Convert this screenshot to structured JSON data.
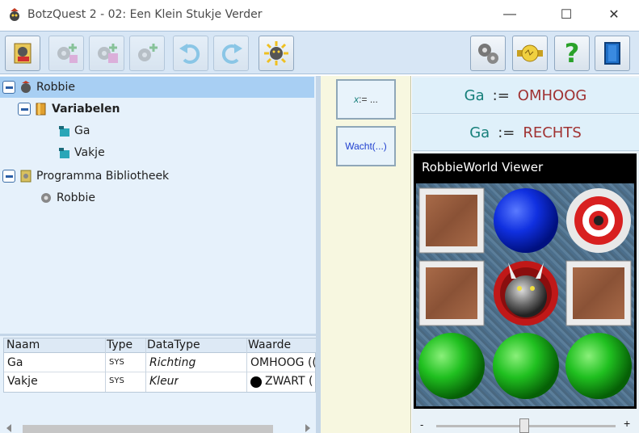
{
  "window": {
    "title": "BotzQuest 2 - 02: Een Klein Stukje Verder",
    "minimize_label": "—",
    "maximize_label": "☐",
    "close_label": "✕"
  },
  "toolbar": {
    "left_buttons": [
      "robot-editor",
      "add-gear",
      "add-gear-2",
      "add-gear-3",
      "undo",
      "redo",
      "run"
    ],
    "right_buttons": [
      "settings",
      "badge",
      "help",
      "exit"
    ],
    "help_glyph": "?"
  },
  "tree": {
    "root_label": "Robbie",
    "variables_label": "Variabelen",
    "var_ga": "Ga",
    "var_vakje": "Vakje",
    "library_label": "Programma Bibliotheek",
    "library_robbie": "Robbie"
  },
  "grid": {
    "columns": [
      "Naam",
      "Type",
      "DataType",
      "Waarde"
    ],
    "rows": [
      {
        "naam": "Ga",
        "type": "SYS",
        "datatype": "Richting",
        "waarde": "OMHOOG (("
      },
      {
        "naam": "Vakje",
        "type": "SYS",
        "datatype": "Kleur",
        "waarde": "ZWART ("
      }
    ]
  },
  "commands": {
    "assign_var": "x",
    "assign_op": " := ...",
    "wait_label": "Wacht(...)"
  },
  "statements": [
    {
      "var": "Ga",
      "op": ":=",
      "value": "OMHOOG"
    },
    {
      "var": "Ga",
      "op": ":=",
      "value": "RECHTS"
    }
  ],
  "viewer": {
    "title": "RobbieWorld Viewer",
    "grid": [
      [
        "crate",
        "blue-ball",
        "target"
      ],
      [
        "crate",
        "robot",
        "crate"
      ],
      [
        "green-ball",
        "green-ball",
        "green-ball"
      ]
    ]
  },
  "slider": {
    "minus_label": "-",
    "plus_label": "+"
  },
  "colors": {
    "toolbar_bg": "#d7e6f5",
    "tree_bg": "#e6f1fb",
    "selection": "#a8cff3",
    "var_color": "#167f7a",
    "value_color": "#a03232"
  }
}
